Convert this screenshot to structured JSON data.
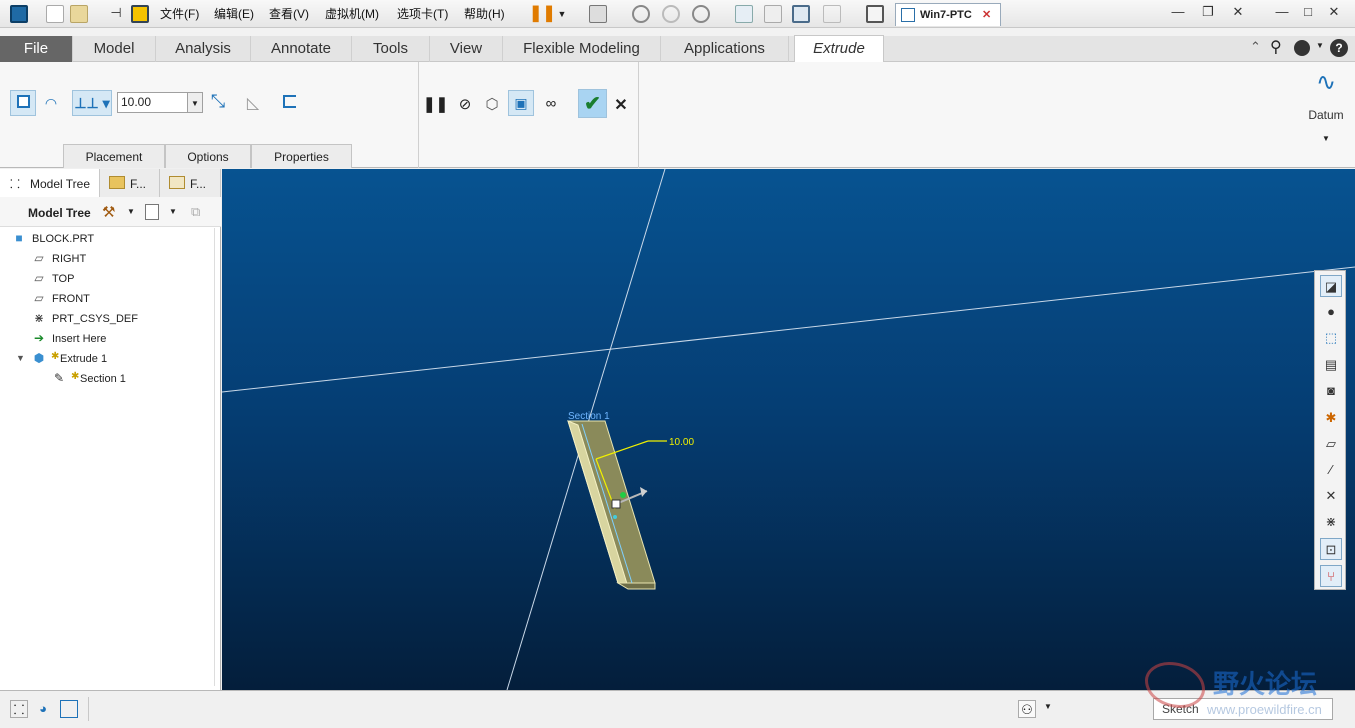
{
  "titlebar": {
    "menu": [
      "文件(F)",
      "编辑(E)",
      "查看(V)",
      "虚拟机(M)",
      "选项卡(T)",
      "帮助(H)"
    ],
    "vm_tab_label": "Win7-PTC",
    "vm_tab_close": "✕",
    "win_minimize": "—",
    "win_restore": "❐",
    "win_close": "✕"
  },
  "app_window_controls": {
    "minimize": "—",
    "maximize": "□",
    "close": "✕"
  },
  "ribbon": {
    "tabs": [
      "File",
      "Model",
      "Analysis",
      "Annotate",
      "Tools",
      "View",
      "Flexible Modeling",
      "Applications",
      "Extrude"
    ],
    "depth_value": "10.00",
    "panel_tabs": [
      "Placement",
      "Options",
      "Properties"
    ],
    "datum_label": "Datum"
  },
  "sidebar": {
    "tabs": [
      "Model Tree",
      "F...",
      "F..."
    ],
    "toolbar_title": "Model Tree",
    "tree": [
      {
        "label": "BLOCK.PRT",
        "icon": "part-icon",
        "indent": 0
      },
      {
        "label": "RIGHT",
        "icon": "datum-plane-icon",
        "indent": 1
      },
      {
        "label": "TOP",
        "icon": "datum-plane-icon",
        "indent": 1
      },
      {
        "label": "FRONT",
        "icon": "datum-plane-icon",
        "indent": 1
      },
      {
        "label": "PRT_CSYS_DEF",
        "icon": "csys-icon",
        "indent": 1
      },
      {
        "label": "Insert Here",
        "icon": "insert-arrow-icon",
        "indent": 1
      },
      {
        "label": "Extrude 1",
        "icon": "extrude-icon",
        "indent": 1
      },
      {
        "label": "Section 1",
        "icon": "sketch-icon",
        "indent": 2
      }
    ]
  },
  "viewport": {
    "section_label": "Section 1",
    "dimension_label": "10.00"
  },
  "statusbar": {
    "filter_value": "Sketch"
  },
  "watermark": {
    "text_cn": "野火论坛",
    "url": "www.proewildfire.cn"
  },
  "colors": {
    "accent": "#1e72b8",
    "viewport_top": "#075391",
    "viewport_bottom": "#041e3b",
    "part_face": "#8b8a5a",
    "part_edge": "#f3f0c0",
    "dimension": "#f0f000"
  }
}
